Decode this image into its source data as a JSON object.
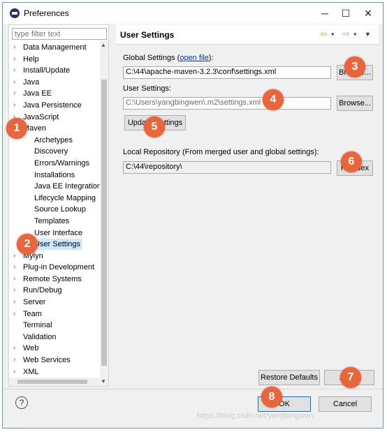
{
  "window": {
    "title": "Preferences",
    "minimize": "─",
    "maximize": "☐",
    "close": "✕"
  },
  "filter": {
    "placeholder": "type filter text"
  },
  "tree": [
    {
      "label": "Data Management",
      "arrow": "›"
    },
    {
      "label": "Help",
      "arrow": "›"
    },
    {
      "label": "Install/Update",
      "arrow": "›"
    },
    {
      "label": "Java",
      "arrow": "›"
    },
    {
      "label": "Java EE",
      "arrow": "›"
    },
    {
      "label": "Java Persistence",
      "arrow": "›"
    },
    {
      "label": "JavaScript",
      "arrow": "›"
    },
    {
      "label": "Maven",
      "arrow": "⌄"
    },
    {
      "label": "Archetypes"
    },
    {
      "label": "Discovery"
    },
    {
      "label": "Errors/Warnings"
    },
    {
      "label": "Installations"
    },
    {
      "label": "Java EE Integration"
    },
    {
      "label": "Lifecycle Mapping"
    },
    {
      "label": "Source Lookup"
    },
    {
      "label": "Templates"
    },
    {
      "label": "User Interface"
    },
    {
      "label": "User Settings",
      "selected": true
    },
    {
      "label": "Mylyn",
      "arrow": "›"
    },
    {
      "label": "Plug-in Development",
      "arrow": "›"
    },
    {
      "label": "Remote Systems",
      "arrow": "›"
    },
    {
      "label": "Run/Debug",
      "arrow": "›"
    },
    {
      "label": "Server",
      "arrow": "›"
    },
    {
      "label": "Team",
      "arrow": "›"
    },
    {
      "label": "Terminal"
    },
    {
      "label": "Validation"
    },
    {
      "label": "Web",
      "arrow": "›"
    },
    {
      "label": "Web Services",
      "arrow": "›"
    },
    {
      "label": "XML",
      "arrow": "›"
    }
  ],
  "page": {
    "title": "User Settings",
    "nav": {
      "back": "⇦",
      "back_menu": "▾",
      "forward": "⇨",
      "forward_menu": "▾",
      "view_menu": "▼"
    },
    "global_label": "Global Settings (",
    "global_link": "open file",
    "global_label_end": "):",
    "global_value": "C:\\44\\apache-maven-3.2.3\\conf\\settings.xml",
    "global_browse": "Browse...",
    "user_label": "User Settings:",
    "user_value": "C:\\Users\\yangbingwen\\.m2\\settings.xml",
    "user_browse": "Browse...",
    "update_button": "Update Settings",
    "local_label": "Local Repository (From merged user and global settings):",
    "local_value": "C:\\44\\repository\\",
    "reindex_button": "Reindex",
    "restore_button": "Restore Defaults",
    "apply_button": "Apply"
  },
  "footer": {
    "help": "?",
    "ok": "OK",
    "cancel": "Cancel"
  },
  "callouts": [
    "1",
    "2",
    "3",
    "4",
    "5",
    "6",
    "7",
    "8"
  ],
  "watermark": "https://blog.csdn.net/yangbingwen",
  "colors": {
    "callout": "#e8663b",
    "link": "#0033cc",
    "selection": "#cde8ff"
  }
}
